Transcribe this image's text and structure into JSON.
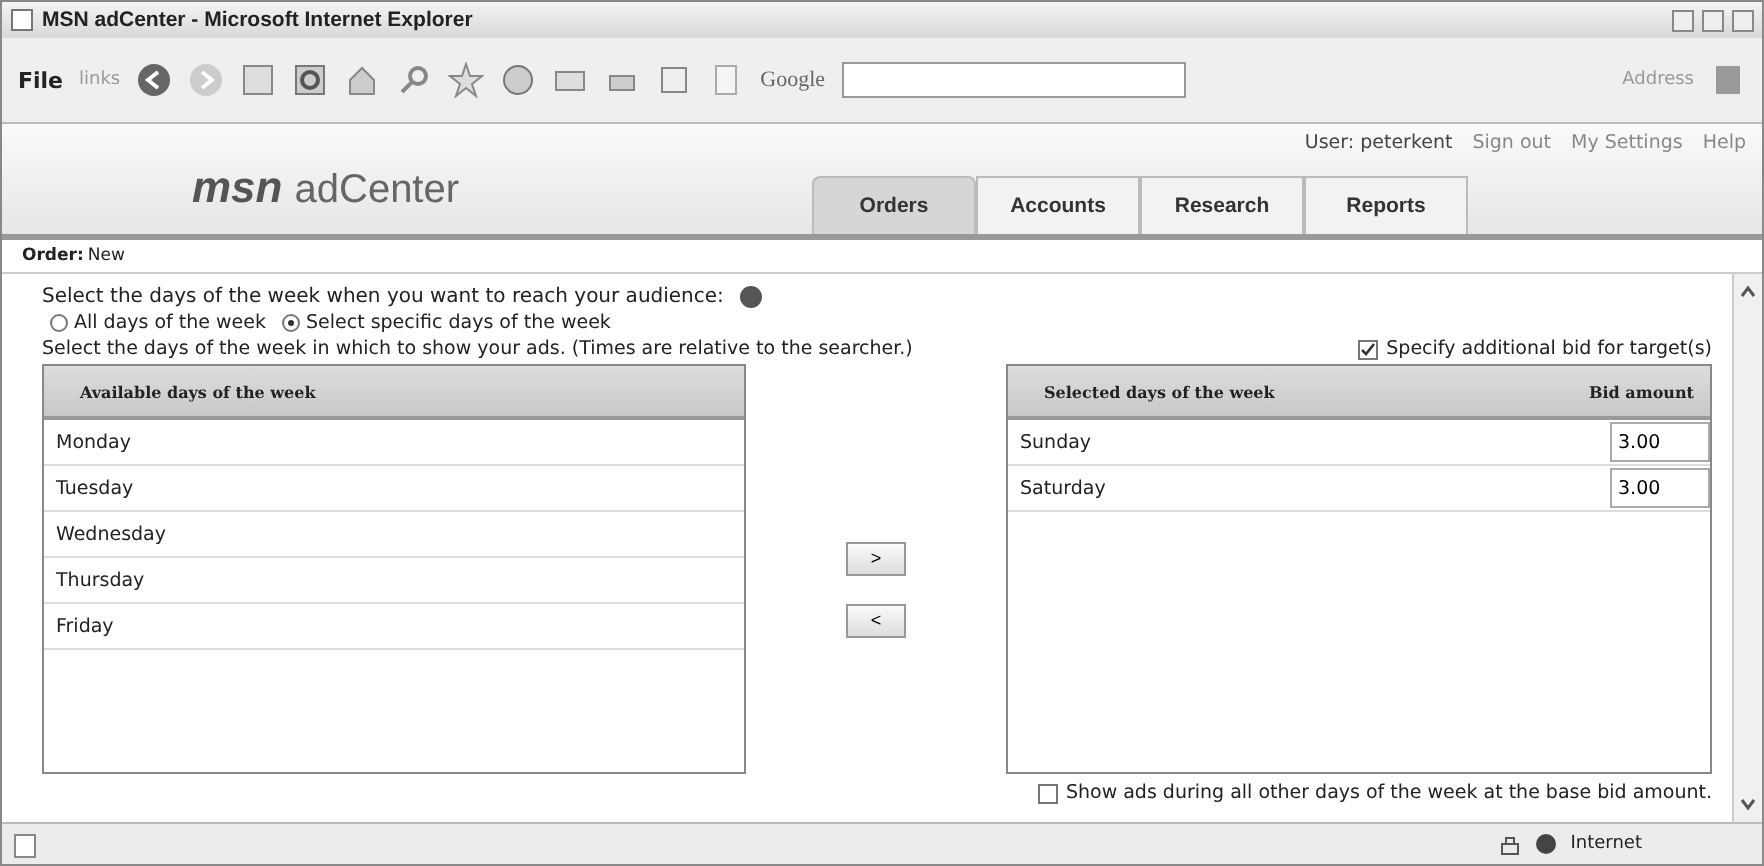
{
  "window": {
    "title": "MSN adCenter - Microsoft Internet Explorer"
  },
  "toolbar": {
    "menu": "File",
    "links": "links",
    "search_label": "Google",
    "address_label": "Address"
  },
  "header": {
    "logo_mark": "msn",
    "logo_text": "adCenter",
    "user_links": [
      "User: peterkent",
      "Sign out",
      "My Settings",
      "Help"
    ]
  },
  "tabs": [
    {
      "label": "Orders",
      "selected": true
    },
    {
      "label": "Accounts",
      "selected": false
    },
    {
      "label": "Research",
      "selected": false
    },
    {
      "label": "Reports",
      "selected": false
    }
  ],
  "order": {
    "label": "Order:",
    "value": "New"
  },
  "prompt": "Select the days of the week when you want to reach your audience:",
  "radios": [
    {
      "label": "All days of the week",
      "selected": false
    },
    {
      "label": "Select specific days of the week",
      "selected": true
    }
  ],
  "instruction": "Select the days of the week in which to show your ads. (Times are relative to the searcher.)",
  "additional_bid": {
    "label": "Specify additional bid for target(s)",
    "checked": true
  },
  "available": {
    "header": "Available days of the week",
    "rows": [
      "Monday",
      "Tuesday",
      "Wednesday",
      "Thursday",
      "Friday"
    ]
  },
  "move_buttons": [
    ">",
    "<"
  ],
  "selected_days": {
    "columns": [
      "Selected days of the week",
      "Bid amount"
    ],
    "rows": [
      {
        "day": "Sunday",
        "bid": "3.00"
      },
      {
        "day": "Saturday",
        "bid": "3.00"
      }
    ]
  },
  "other_days": {
    "label": "Show ads during all other days of the week at the base bid amount.",
    "checked": false
  },
  "status_bar": {
    "zone": "Internet"
  }
}
